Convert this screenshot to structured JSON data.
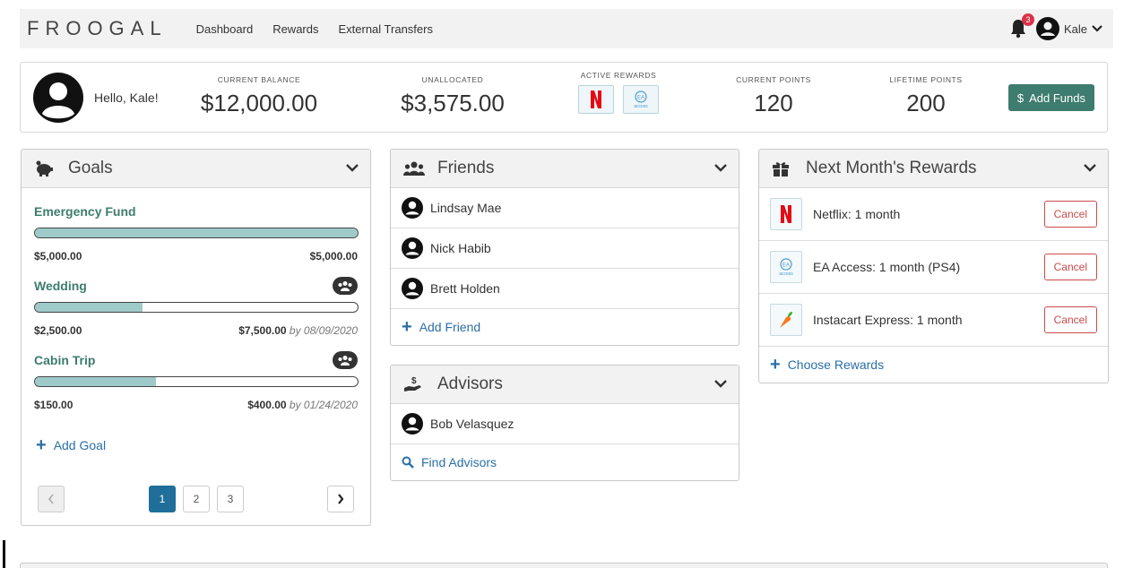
{
  "nav": {
    "brand": "FROOGAL",
    "links": [
      "Dashboard",
      "Rewards",
      "External Transfers"
    ],
    "notification_count": "3",
    "user_name": "Kale"
  },
  "summary": {
    "greeting": "Hello, Kale!",
    "current_balance_label": "CURRENT BALANCE",
    "current_balance": "$12,000.00",
    "unallocated_label": "UNALLOCATED",
    "unallocated": "$3,575.00",
    "active_rewards_label": "ACTIVE REWARDS",
    "current_points_label": "CURRENT POINTS",
    "current_points": "120",
    "lifetime_points_label": "LIFETIME POINTS",
    "lifetime_points": "200",
    "add_funds_label": "Add Funds",
    "add_funds_icon": "$"
  },
  "goals": {
    "title": "Goals",
    "items": [
      {
        "name": "Emergency Fund",
        "saved": "$5,000.00",
        "target": "$5,000.00",
        "by_text": "",
        "progress": 1.0,
        "group": false
      },
      {
        "name": "Wedding",
        "saved": "$2,500.00",
        "target": "$7,500.00",
        "by_text": "by 08/09/2020",
        "progress": 0.333,
        "group": true
      },
      {
        "name": "Cabin Trip",
        "saved": "$150.00",
        "target": "$400.00",
        "by_text": "by 01/24/2020",
        "progress": 0.375,
        "group": true
      }
    ],
    "add_label": "Add Goal",
    "pages": [
      "1",
      "2",
      "3"
    ]
  },
  "friends": {
    "title": "Friends",
    "items": [
      "Lindsay Mae",
      "Nick Habib",
      "Brett Holden"
    ],
    "add_label": "Add Friend"
  },
  "advisors": {
    "title": "Advisors",
    "items": [
      "Bob Velasquez"
    ],
    "find_label": "Find Advisors"
  },
  "next_rewards": {
    "title": "Next Month's Rewards",
    "items": [
      {
        "label": "Netflix: 1 month",
        "logo": "netflix-logo"
      },
      {
        "label": "EA Access: 1 month (PS4)",
        "logo": "ea-access-logo"
      },
      {
        "label": "Instacart Express: 1 month",
        "logo": "instacart-logo"
      }
    ],
    "cancel_label": "Cancel",
    "choose_label": "Choose Rewards"
  },
  "logo_text": {
    "ea": "EA",
    "access": "access"
  },
  "colors": {
    "accent_green": "#3d7c6e",
    "link_blue": "#2a6fa6",
    "progress_fill": "#9ecaca",
    "cancel_red": "#c94b4b",
    "netflix_red": "#e50914"
  }
}
